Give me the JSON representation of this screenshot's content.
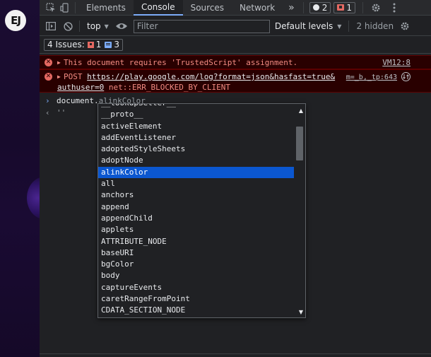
{
  "page": {
    "logo_text": "EJ"
  },
  "tabbar": {
    "tabs": [
      {
        "label": "Elements",
        "active": false
      },
      {
        "label": "Console",
        "active": true
      },
      {
        "label": "Sources",
        "active": false
      },
      {
        "label": "Network",
        "active": false
      }
    ],
    "more_glyph": "»",
    "warnings_count": "2",
    "errors_count": "1"
  },
  "toolbar": {
    "context": "top",
    "filter_placeholder": "Filter",
    "levels_label": "Default levels",
    "hidden_label": "2 hidden"
  },
  "issues": {
    "label": "4 Issues:",
    "error_count": "1",
    "info_count": "3"
  },
  "messages": [
    {
      "text": "This document requires 'TrustedScript' assignment.",
      "source": "VM12:8"
    },
    {
      "prefix": "POST ",
      "url_line1": "https://play.google.com/log?format=json&hasfast=true&",
      "url_line2": "authuser=0",
      "error": " net::ERR_BLOCKED_BY_CLIENT",
      "source": "m=_b,_tp:643"
    }
  ],
  "prompt": {
    "typed": "document.",
    "suggestion": "alinkColor",
    "result": "''"
  },
  "autocomplete": {
    "items": [
      "__lookupSetter__",
      "__proto__",
      "activeElement",
      "addEventListener",
      "adoptedStyleSheets",
      "adoptNode",
      "alinkColor",
      "all",
      "anchors",
      "append",
      "appendChild",
      "applets",
      "ATTRIBUTE_NODE",
      "baseURI",
      "bgColor",
      "body",
      "captureEvents",
      "caretRangeFromPoint",
      "CDATA_SECTION_NODE"
    ],
    "selected": "alinkColor"
  }
}
